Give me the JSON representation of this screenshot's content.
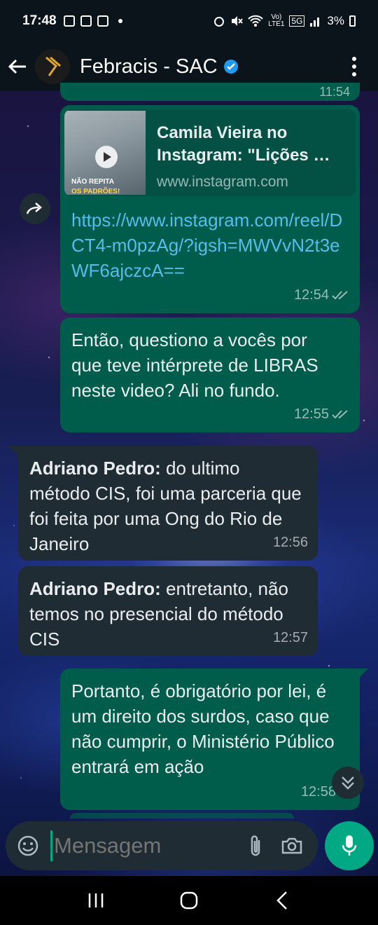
{
  "status_bar": {
    "time": "17:48",
    "network_top": "Vo)",
    "network_bottom": "LTE1",
    "network_gen": "5G",
    "battery": "3%"
  },
  "header": {
    "title": "Febracis - SAC"
  },
  "messages": {
    "prev_time": "11:54",
    "link_card": {
      "preview_title": "Camila Vieira no Instagram: \"Lições …",
      "preview_domain": "www.instagram.com",
      "thumb_caption_1": "NÃO REPITA",
      "thumb_caption_2": "OS PADRÕES!",
      "url": "https://www.instagram.com/reel/DCT4-m0pzAg/?igsh=MWVvN2t3eWF6ajczcA==",
      "time": "12:54"
    },
    "m2": {
      "text": "Então, questiono a vocês por que teve intérprete de LIBRAS neste video? Ali no fundo.",
      "time": "12:55"
    },
    "m3": {
      "sender": "Adriano Pedro:",
      "text": " do ultimo método CIS, foi uma parceria que foi feita por uma Ong do Rio de Janeiro",
      "time": "12:56"
    },
    "m4": {
      "sender": "Adriano Pedro:",
      "text": " entretanto, não temos no presencial do método CIS",
      "time": "12:57"
    },
    "m5": {
      "text": "Portanto, é obrigatório por lei, é um direito dos surdos, caso que não cumprir, o Ministério Público entrará em ação",
      "time": "12:58"
    }
  },
  "composer": {
    "placeholder": "Mensagem"
  },
  "colors": {
    "outgoing_bubble": "#005c4b",
    "incoming_bubble": "#202c33",
    "accent": "#00a884",
    "link": "#53bdeb"
  }
}
